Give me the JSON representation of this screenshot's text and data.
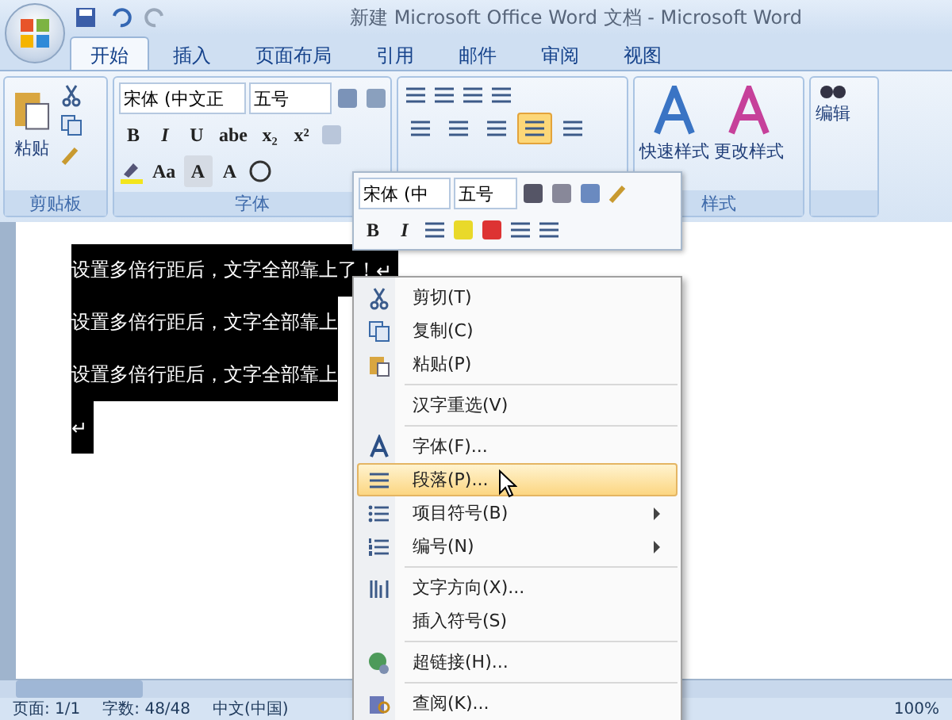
{
  "window": {
    "title": "新建 Microsoft Office Word 文档 - Microsoft Word"
  },
  "tabs": [
    {
      "label": "开始",
      "selected": true
    },
    {
      "label": "插入",
      "selected": false
    },
    {
      "label": "页面布局",
      "selected": false
    },
    {
      "label": "引用",
      "selected": false
    },
    {
      "label": "邮件",
      "selected": false
    },
    {
      "label": "审阅",
      "selected": false
    },
    {
      "label": "视图",
      "selected": false
    }
  ],
  "ribbon": {
    "clipboard": {
      "label": "剪贴板",
      "paste": "粘贴"
    },
    "font": {
      "label": "字体",
      "font_name": "宋体 (中文正",
      "font_size": "五号",
      "format_buttons": [
        "B",
        "I",
        "U",
        "abe",
        "x₂",
        "x²"
      ],
      "bottom_buttons": [
        "Aa",
        "A",
        "A"
      ]
    },
    "paragraph": {
      "align_buttons": [
        {
          "selected": false
        },
        {
          "selected": false
        },
        {
          "selected": false
        },
        {
          "selected": true
        },
        {
          "selected": false
        }
      ]
    },
    "styles": {
      "label": "样式",
      "buttons": [
        "快速样式",
        "更改样式"
      ]
    },
    "editing": {
      "button": "编辑"
    }
  },
  "mini_toolbar": {
    "font_name": "宋体 (中",
    "font_size": "五号",
    "format_buttons": [
      "B",
      "I"
    ]
  },
  "document": {
    "lines": [
      {
        "text": "设置多倍行距后，文字全部靠上了！",
        "mark": "↵"
      },
      {
        "text": "设置多倍行距后，文字全部靠上"
      },
      {
        "text": "设置多倍行距后，文字全部靠上"
      },
      {
        "mark": "↵"
      }
    ]
  },
  "context_menu": {
    "groups": [
      [
        {
          "label": "剪切(T)",
          "selected": false
        },
        {
          "label": "复制(C)",
          "selected": false
        },
        {
          "label": "粘贴(P)",
          "selected": false
        }
      ],
      [
        {
          "label": "汉字重选(V)",
          "selected": false
        }
      ],
      [
        {
          "label": "字体(F)...",
          "selected": false
        },
        {
          "label": "段落(P)...",
          "selected": true
        },
        {
          "label": "项目符号(B)",
          "selected": false,
          "submenu": true
        },
        {
          "label": "编号(N)",
          "selected": false,
          "submenu": true
        }
      ],
      [
        {
          "label": "文字方向(X)...",
          "selected": false
        },
        {
          "label": "插入符号(S)",
          "selected": false
        }
      ],
      [
        {
          "label": "超链接(H)...",
          "selected": false
        }
      ],
      [
        {
          "label": "查阅(K)...",
          "selected": false
        }
      ]
    ]
  },
  "status_bar": {
    "items": [
      "页面: 1/1",
      "字数: 48/48",
      "中文(中国)"
    ],
    "zoom": "100%"
  }
}
